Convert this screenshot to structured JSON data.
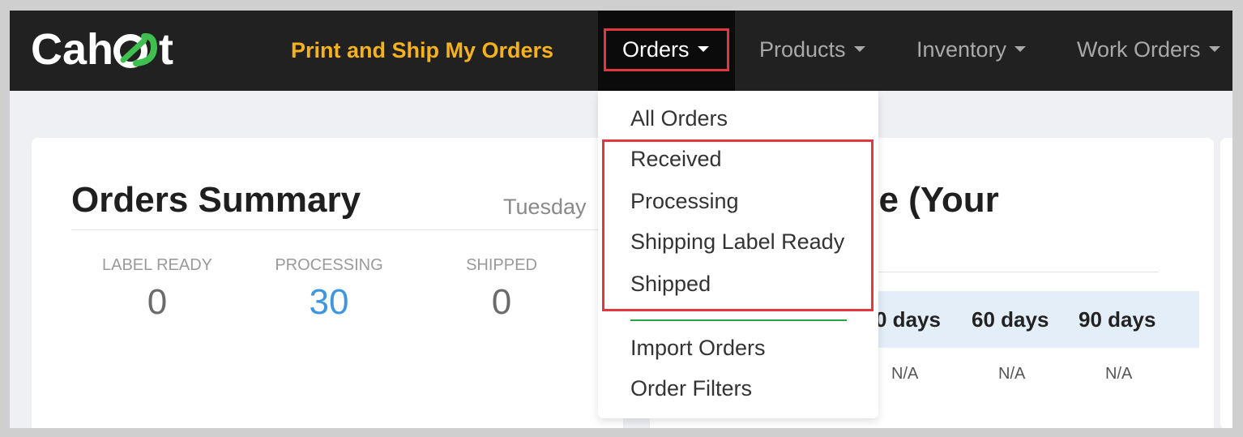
{
  "brand": {
    "logo_pre": "Cah",
    "logo_post": "t",
    "colors": {
      "ring_white": "#ffffff",
      "ring_green": "#3fbf4f"
    }
  },
  "nav": {
    "highlight_link": "Print and Ship My Orders",
    "items": [
      {
        "label": "Orders",
        "active": true
      },
      {
        "label": "Products"
      },
      {
        "label": "Inventory"
      },
      {
        "label": "Work Orders"
      }
    ]
  },
  "dropdown": {
    "items": [
      "All Orders",
      "Received",
      "Processing",
      "Shipping Label Ready",
      "Shipped",
      "Import Orders",
      "Order Filters"
    ]
  },
  "summary": {
    "title": "Orders Summary",
    "date": "Tuesday",
    "stats": [
      {
        "label": "LABEL READY",
        "value": "0"
      },
      {
        "label": "PROCESSING",
        "value": "30"
      },
      {
        "label": "SHIPPED",
        "value": "0"
      }
    ]
  },
  "performance": {
    "title_fragment": "ce (Your",
    "columns": [
      "0 days",
      "60 days",
      "90 days"
    ],
    "values": [
      "N/A",
      "N/A",
      "N/A"
    ]
  },
  "colors": {
    "accent_orange": "#f6b21b",
    "highlight_red": "#e2373f",
    "link_blue": "#3d97e0",
    "divider_green": "#2ca24b",
    "navbar": "#212121"
  }
}
